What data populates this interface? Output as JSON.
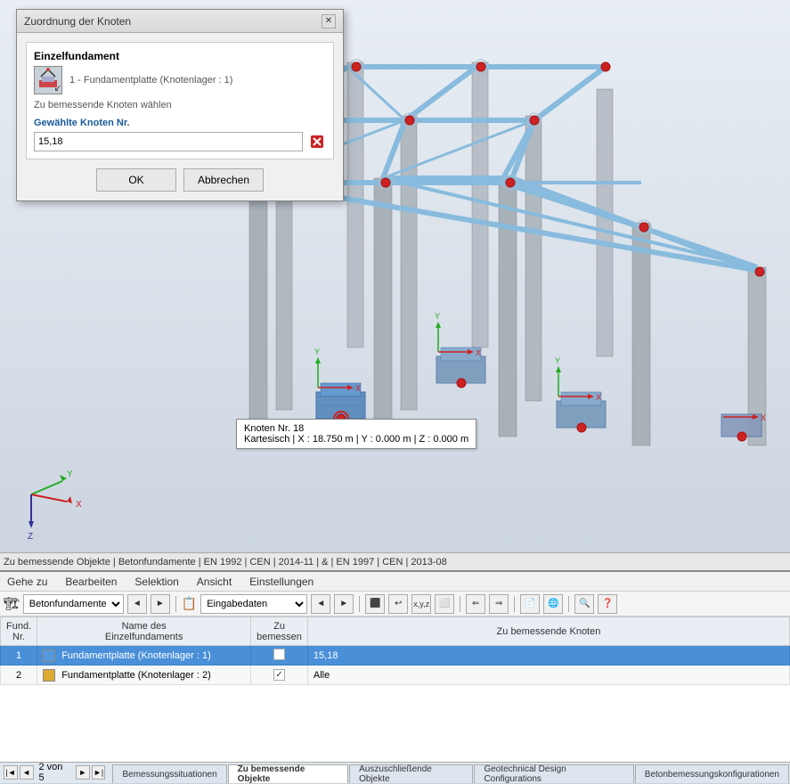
{
  "dialog": {
    "title": "Zuordnung der Knoten",
    "section_title": "Einzelfundament",
    "dropdown_label": "1 - Fundamentplatte (Knotenlager : 1)",
    "action_text": "Zu bemessende Knoten wählen",
    "field_label": "Gewählte Knoten Nr.",
    "field_value": "15,18",
    "ok_label": "OK",
    "cancel_label": "Abbrechen"
  },
  "status_bar": {
    "text": "Zu bemessende Objekte | Betonfundamente | EN 1992 | CEN | 2014-11 | & | EN 1997 | CEN | 2013-08"
  },
  "menu": {
    "items": [
      "Gehe zu",
      "Bearbeiten",
      "Selektion",
      "Ansicht",
      "Einstellungen"
    ]
  },
  "toolbar": {
    "module_label": "Betonfundamente",
    "view_label": "Eingabedaten",
    "nav_text": "2 von 5"
  },
  "table": {
    "headers": {
      "col1": "Fund.\nNr.",
      "col2": "Name des\nEinzelfundaments",
      "col3": "Zu\nbemessen",
      "col4": "Zu bemessende Knoten"
    },
    "rows": [
      {
        "nr": "1",
        "color": "#5599dd",
        "name": "Fundamentplatte (Knotenlager : 1)",
        "checked": false,
        "knoten": "15,18",
        "selected": true
      },
      {
        "nr": "2",
        "color": "#ddaa33",
        "name": "Fundamentplatte (Knotenlager : 2)",
        "checked": true,
        "knoten": "Alle",
        "selected": false
      }
    ]
  },
  "bottom_tabs": [
    {
      "label": "Bemessungssituationen",
      "active": false
    },
    {
      "label": "Zu bemessende Objekte",
      "active": true
    },
    {
      "label": "Auszuschließende Objekte",
      "active": false
    },
    {
      "label": "Geotechnical Design Configurations",
      "active": false
    },
    {
      "label": "Betonbemessungskonfigurationen",
      "active": false
    }
  ],
  "tooltip": {
    "line1": "Knoten Nr. 18",
    "line2": "Kartesisch | X : 18.750 m | Y : 0.000 m | Z : 0.000 m"
  },
  "icons": {
    "prev_page": "◄",
    "next_page": "►",
    "first_page": "|◄",
    "last_page": "►|",
    "x_axis": "X",
    "y_axis": "Y",
    "z_axis": "Z"
  }
}
